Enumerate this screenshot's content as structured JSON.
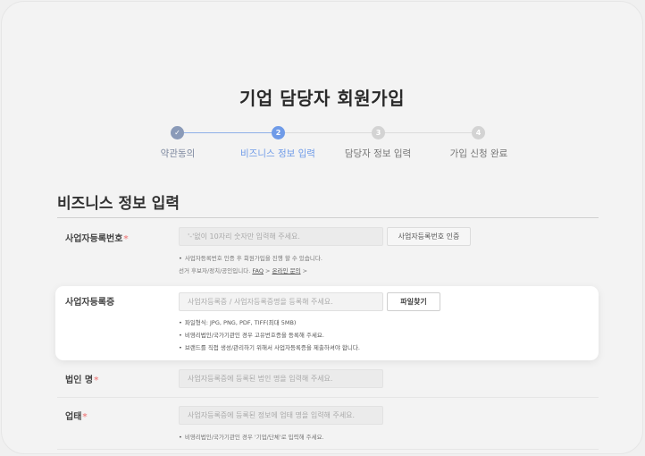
{
  "page": {
    "title": "기업 담당자 회원가입"
  },
  "steps": [
    {
      "label": "약관동의",
      "marker": "✓",
      "state": "done"
    },
    {
      "label": "비즈니스 정보 입력",
      "marker": "2",
      "state": "current"
    },
    {
      "label": "담당자 정보 입력",
      "marker": "3",
      "state": "todo"
    },
    {
      "label": "가입 신청 완료",
      "marker": "4",
      "state": "todo"
    }
  ],
  "colors": {
    "accent": "#6f9be8",
    "done": "#8a9ab8",
    "todo": "#d3d3d3",
    "required": "#f08a8a"
  },
  "section": {
    "title": "비즈니스 정보 입력"
  },
  "fields": {
    "biz_number": {
      "label": "사업자등록번호",
      "required_mark": "*",
      "placeholder": "'-'없이 10자리 숫자만 입력해 주세요.",
      "button": "사업자등록번호 인증",
      "note1": "사업자등록번호 인증 후 회원가입을 진행 할 수 있습니다.",
      "note2_prefix": "선거 후보자/정치/공인입니다.",
      "faq_link": "FAQ",
      "faq_arrow": ">",
      "online_link": "온라인 문의",
      "online_arrow": ">"
    },
    "biz_cert": {
      "label": "사업자등록증",
      "placeholder": "사업자등록증 / 사업자등록증명을 등록해 주세요.",
      "button": "파일찾기",
      "notes": [
        "파일형식: JPG, PNG, PDF, TIFF(최대 5MB)",
        "비영리법인/국가기관인 경우 고유번호증을 등록해 주세요.",
        "브랜드를 직접 생성/관리하기 위해서 사업자등록증을 제출하셔야 합니다."
      ]
    },
    "corp_name": {
      "label": "법인 명",
      "required_mark": "*",
      "placeholder": "사업자등록증에 등록된 법인 명을 입력해 주세요."
    },
    "industry": {
      "label": "업태",
      "required_mark": "*",
      "placeholder": "사업자등록증에 등록된 정보에 업태 명을 입력해 주세요.",
      "note": "비영리법인/국가기관인 경우 '기업/단체'로 입력해 주세요."
    }
  }
}
